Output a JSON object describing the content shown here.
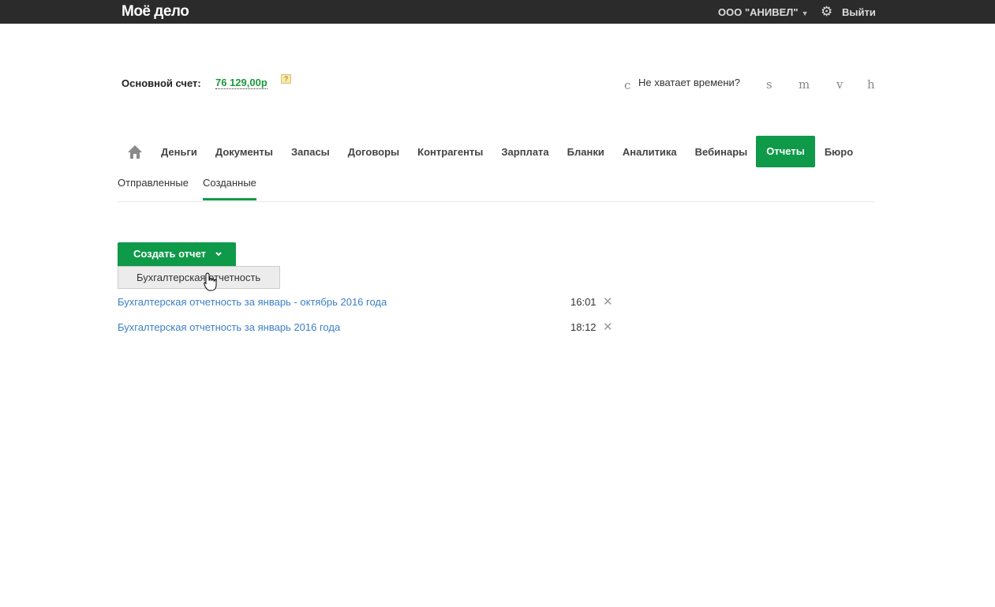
{
  "header": {
    "logo": "Moё дело",
    "org": "ООО \"АНИВЕЛ\"",
    "logout": "Выйти"
  },
  "account": {
    "label": "Основной счет:",
    "value": "76 129,00р",
    "help": "?"
  },
  "promo": {
    "c": "c",
    "text": "Не хватает времени?",
    "s": "s",
    "m": "m",
    "v": "v",
    "h": "h"
  },
  "nav": {
    "items": [
      "Деньги",
      "Документы",
      "Запасы",
      "Договоры",
      "Контрагенты",
      "Зарплата",
      "Бланки",
      "Аналитика",
      "Вебинары",
      "Отчеты",
      "Бюро"
    ],
    "active": "Отчеты"
  },
  "subtabs": [
    "Отправленные",
    "Созданные"
  ],
  "create": {
    "label": "Создать отчет",
    "menu": [
      "Бухгалтерская отчетность"
    ]
  },
  "reports": [
    {
      "title": "Бухгалтерская отчетность за январь - октябрь 2016 года",
      "time": "16:01"
    },
    {
      "title": "Бухгалтерская отчетность за январь 2016 года",
      "time": "18:12"
    }
  ],
  "colors": {
    "accent": "#0e9a48",
    "link": "#3b7fc4",
    "topbar": "#2b2b2b"
  }
}
